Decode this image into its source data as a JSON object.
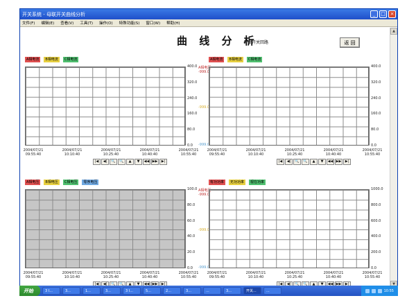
{
  "window": {
    "title": "开关系统 - 母联开关曲线分析",
    "controls": [
      "_",
      "□",
      "×"
    ]
  },
  "menu": [
    "文件(F)",
    "编辑(E)",
    "查看(V)",
    "工具(T)",
    "操作(O)",
    "特殊功能(S)",
    "窗口(W)",
    "帮助(H)"
  ],
  "page": {
    "title": "曲 线 分 析",
    "subtitle": "母联开关回路",
    "back_label": "返 回"
  },
  "x_ticks": [
    {
      "date": "2004/07/21",
      "time": "09:55:40"
    },
    {
      "date": "2004/07/21",
      "time": "10:10:40"
    },
    {
      "date": "2004/07/21",
      "time": "10:25:40"
    },
    {
      "date": "2004/07/21",
      "time": "10:40:40"
    },
    {
      "date": "2004/07/21",
      "time": "10:55:40"
    }
  ],
  "toolbar_icons": [
    "first-icon",
    "prev-page-icon",
    "zoom-out-icon",
    "zoom-in-icon",
    "up-icon",
    "down-icon",
    "rewind-icon",
    "forward-icon",
    "last-icon"
  ],
  "toolbar_glyphs": [
    "|◀",
    "◀|",
    "🔍",
    "🔍",
    "▲",
    "▼",
    "◀◀",
    "▶▶",
    "▶|"
  ],
  "panels": [
    {
      "legend": [
        {
          "label": "A相电流",
          "color": "#e05050"
        },
        {
          "label": "B相电流",
          "color": "#e8d040"
        },
        {
          "label": "C相电流",
          "color": "#50c070"
        }
      ],
      "y_ticks": [
        "400.0",
        "320.0",
        "240.0",
        "160.0",
        "80.0",
        "0.0"
      ],
      "y_label_top": "A相电压",
      "y_label_top2": "-999.0",
      "y_label_mid": "-999.0",
      "y_label_bot": "-999.0",
      "gray": false
    },
    {
      "legend": [
        {
          "label": "A相电流",
          "color": "#e05050"
        },
        {
          "label": "B相电流",
          "color": "#e8d040"
        },
        {
          "label": "C相电流",
          "color": "#50c070"
        }
      ],
      "y_ticks": [
        "400.0",
        "320.0",
        "240.0",
        "160.0",
        "80.0",
        "0.0"
      ],
      "y_label_top": "",
      "y_label_top2": "",
      "y_label_mid": "",
      "y_label_bot": "",
      "gray": false
    },
    {
      "legend": [
        {
          "label": "A相电压",
          "color": "#e05050"
        },
        {
          "label": "B相电压",
          "color": "#e8d040"
        },
        {
          "label": "C相电压",
          "color": "#50c070"
        },
        {
          "label": "零序电压",
          "color": "#70a8e0"
        }
      ],
      "y_ticks": [
        "100.0",
        "80.0",
        "60.0",
        "40.0",
        "20.0",
        "0.0"
      ],
      "y_label_top": "A相电压",
      "y_label_top2": "-999.0",
      "y_label_mid": "-999.0",
      "y_label_bot": "-999.0",
      "gray": true
    },
    {
      "legend": [
        {
          "label": "有功功率",
          "color": "#e05050"
        },
        {
          "label": "无功功率",
          "color": "#e8d040"
        },
        {
          "label": "视在功率",
          "color": "#50c070"
        }
      ],
      "y_ticks": [
        "1000.0",
        "800.0",
        "600.0",
        "400.0",
        "200.0",
        "0.0"
      ],
      "y_label_top": "",
      "y_label_top2": "",
      "y_label_mid": "",
      "y_label_bot": "",
      "gray": false
    }
  ],
  "taskbar": {
    "start": "开始",
    "tasks": [
      "3 I...",
      "3...",
      "1...",
      "3...",
      "3 I...",
      "5...",
      "2...",
      "3...",
      "...",
      "3...",
      "开关...",
      "..."
    ],
    "clock": "10:55"
  }
}
